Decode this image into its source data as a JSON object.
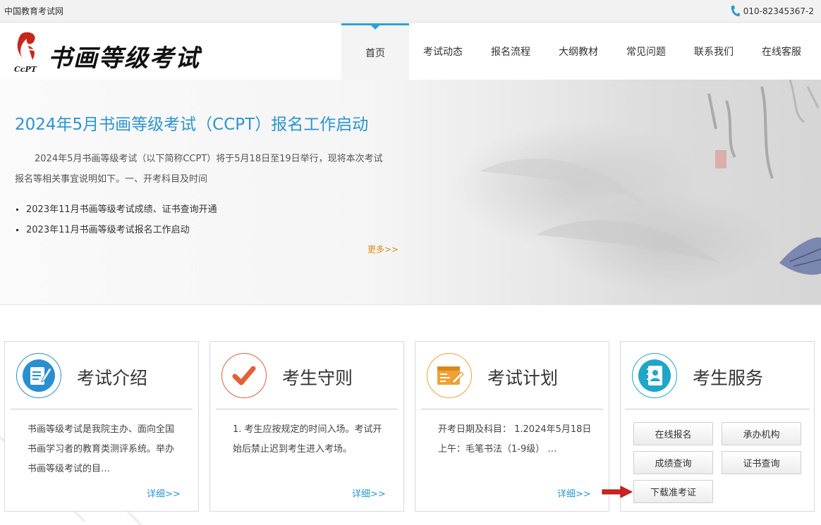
{
  "topbar": {
    "site_name": "中国教育考试网",
    "phone": "010-82345367-2",
    "phone_icon": "phone-icon"
  },
  "header": {
    "logo_mark_text": "CcPT",
    "logo_name": "书画等级考试",
    "nav": [
      {
        "label": "首页",
        "active": true
      },
      {
        "label": "考试动态"
      },
      {
        "label": "报名流程"
      },
      {
        "label": "大纲教材"
      },
      {
        "label": "常见问题"
      },
      {
        "label": "联系我们"
      },
      {
        "label": "在线客服"
      }
    ]
  },
  "banner": {
    "headline": "2024年5月书画等级考试（CCPT）报名工作启动",
    "summary": "2024年5月书画等级考试（以下简称CCPT）将于5月18日至19日举行，现将本次考试报名等相关事宜说明如下。一、开考科目及时间",
    "news": [
      "2023年11月书画等级考试成绩、证书查询开通",
      "2023年11月书画等级考试报名工作启动"
    ],
    "more": "更多>>"
  },
  "cards": [
    {
      "title": "考试介绍",
      "icon": "document-edit-icon",
      "color": "#2a8fd0",
      "body": "书画等级考试是我院主办、面向全国书画学习者的教育类测评系统。举办书画等级考试的目…",
      "detail": "详细>>"
    },
    {
      "title": "考生守则",
      "icon": "checkmark-icon",
      "color": "#e2603a",
      "body": "1. 考生应按规定的时间入场。考试开始后禁止迟到考生进入考场。",
      "detail": "详细>>"
    },
    {
      "title": "考试计划",
      "icon": "calendar-edit-icon",
      "color": "#f0a332",
      "body": "开考日期及科目： 1.2024年5月18日 上午：毛笔书法（1-9级） …",
      "detail": "详细>>"
    },
    {
      "title": "考生服务",
      "icon": "contacts-book-icon",
      "color": "#1fa6c9",
      "buttons": [
        "在线报名",
        "承办机构",
        "成绩查询",
        "证书查询",
        "下载准考证"
      ]
    }
  ]
}
